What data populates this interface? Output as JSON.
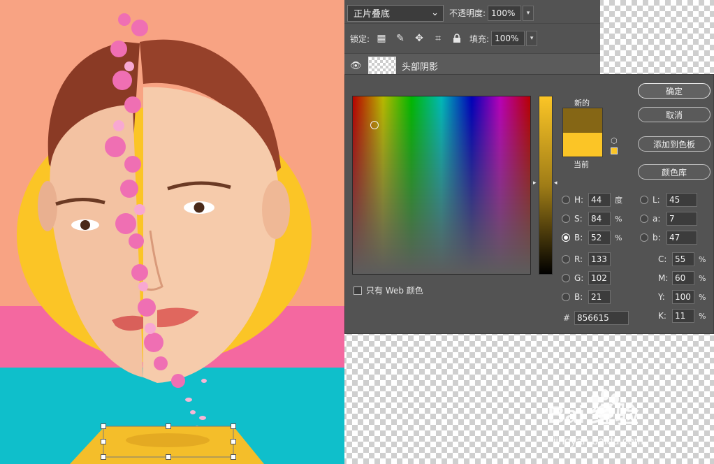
{
  "layers": {
    "blend_mode": "正片叠底",
    "opacity_label": "不透明度:",
    "opacity_value": "100%",
    "lock_label": "锁定:",
    "fill_label": "填充:",
    "fill_value": "100%",
    "layer_name": "头部阴影"
  },
  "picker": {
    "label_new": "新的",
    "label_current": "当前",
    "new_color": "#856615",
    "current_color": "#fbc526",
    "buttons": {
      "ok": "确定",
      "cancel": "取消",
      "add_swatch": "添加到色板",
      "library": "颜色库"
    },
    "web_only": "只有 Web 颜色",
    "hsb": {
      "h_label": "H:",
      "h_value": "44",
      "h_unit": "度",
      "s_label": "S:",
      "s_value": "84",
      "s_unit": "%",
      "b_label": "B:",
      "b_value": "52",
      "b_unit": "%"
    },
    "rgb": {
      "r_label": "R:",
      "r_value": "133",
      "g_label": "G:",
      "g_value": "102",
      "b_label": "B:",
      "b_value": "21"
    },
    "lab": {
      "l_label": "L:",
      "l_value": "45",
      "a_label": "a:",
      "a_value": "7",
      "b_label": "b:",
      "b_value": "47"
    },
    "cmyk": {
      "c_label": "C:",
      "c_value": "55",
      "c_unit": "%",
      "m_label": "M:",
      "m_value": "60",
      "m_unit": "%",
      "y_label": "Y:",
      "y_value": "100",
      "y_unit": "%",
      "k_label": "K:",
      "k_value": "11",
      "k_unit": "%"
    },
    "hex_label": "#",
    "hex_value": "856615"
  },
  "watermark": {
    "brand": "Bai 经验",
    "url": "jingyan.baidu.com"
  },
  "icons": {
    "eye": "eye-icon",
    "lock_transparent": "lock-transparent-pixels-icon",
    "lock_image": "lock-image-pixels-icon",
    "lock_position": "lock-position-icon",
    "lock_artboard": "lock-artboard-icon",
    "lock_all": "lock-all-icon",
    "chevron": "chevron-down-icon"
  }
}
